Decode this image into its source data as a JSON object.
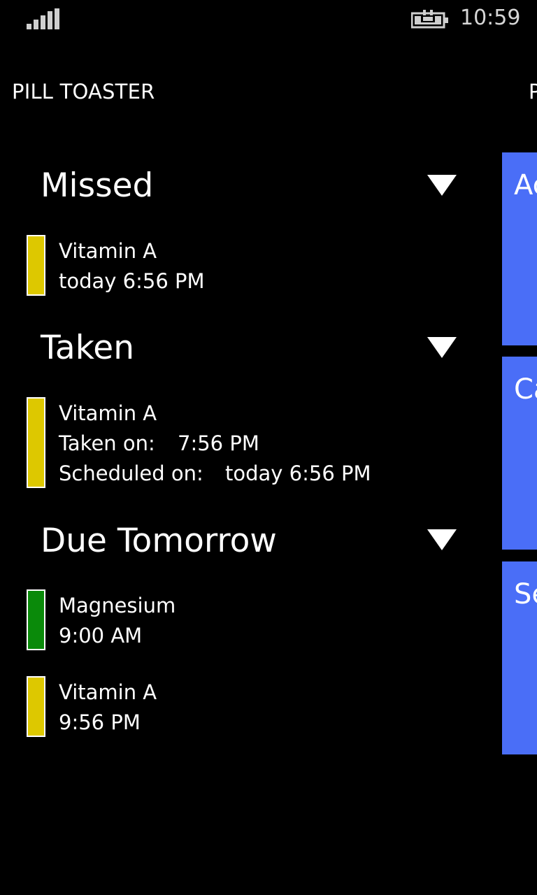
{
  "status_bar": {
    "signal_icon": "signal-bars-icon",
    "battery_icon": "battery-charging-icon",
    "time": "10:59"
  },
  "header": {
    "app_title": "PILL TOASTER",
    "next_pivot_title": "P"
  },
  "groups": {
    "missed": {
      "title": "Missed",
      "items": [
        {
          "name": "Vitamin A",
          "time": "today 6:56 PM",
          "color": "#ddc800"
        }
      ]
    },
    "taken": {
      "title": "Taken",
      "items": [
        {
          "name": "Vitamin A",
          "taken_label": "Taken on:",
          "taken_value": "7:56 PM",
          "scheduled_label": "Scheduled on:",
          "scheduled_value": "today 6:56 PM",
          "color": "#ddc800"
        }
      ]
    },
    "due_tomorrow": {
      "title": "Due Tomorrow",
      "items": [
        {
          "name": "Magnesium",
          "time": "9:00 AM",
          "color": "#0a8a0a"
        },
        {
          "name": "Vitamin A",
          "time": "9:56 PM",
          "color": "#ddc800"
        }
      ]
    }
  },
  "tiles": [
    {
      "label": "Ac"
    },
    {
      "label": "Ca"
    },
    {
      "label": "Se"
    }
  ],
  "colors": {
    "accent_tile": "#4a6ef7",
    "background": "#000000",
    "text": "#ffffff"
  }
}
